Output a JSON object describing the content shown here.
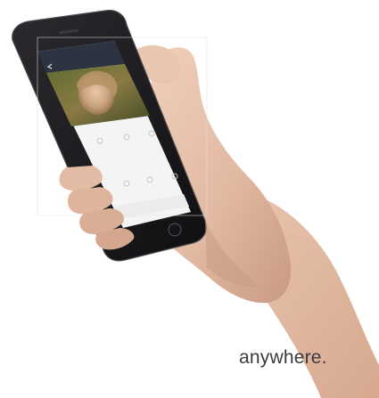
{
  "caption": {
    "text": "anywhere."
  },
  "colors": {
    "background": "#ffffff",
    "skin": "#e7c3ad",
    "skin_shadow": "#c99b83",
    "phone_body": "#1b1b1d",
    "phone_edge": "#4a4a4e",
    "app_header": "#2e3342",
    "screen_panel": "#f4f4f4",
    "caption_text": "#3b3b3b"
  },
  "icons": [
    "home-button-icon",
    "back-arrow-icon",
    "camera-feed-icon"
  ]
}
